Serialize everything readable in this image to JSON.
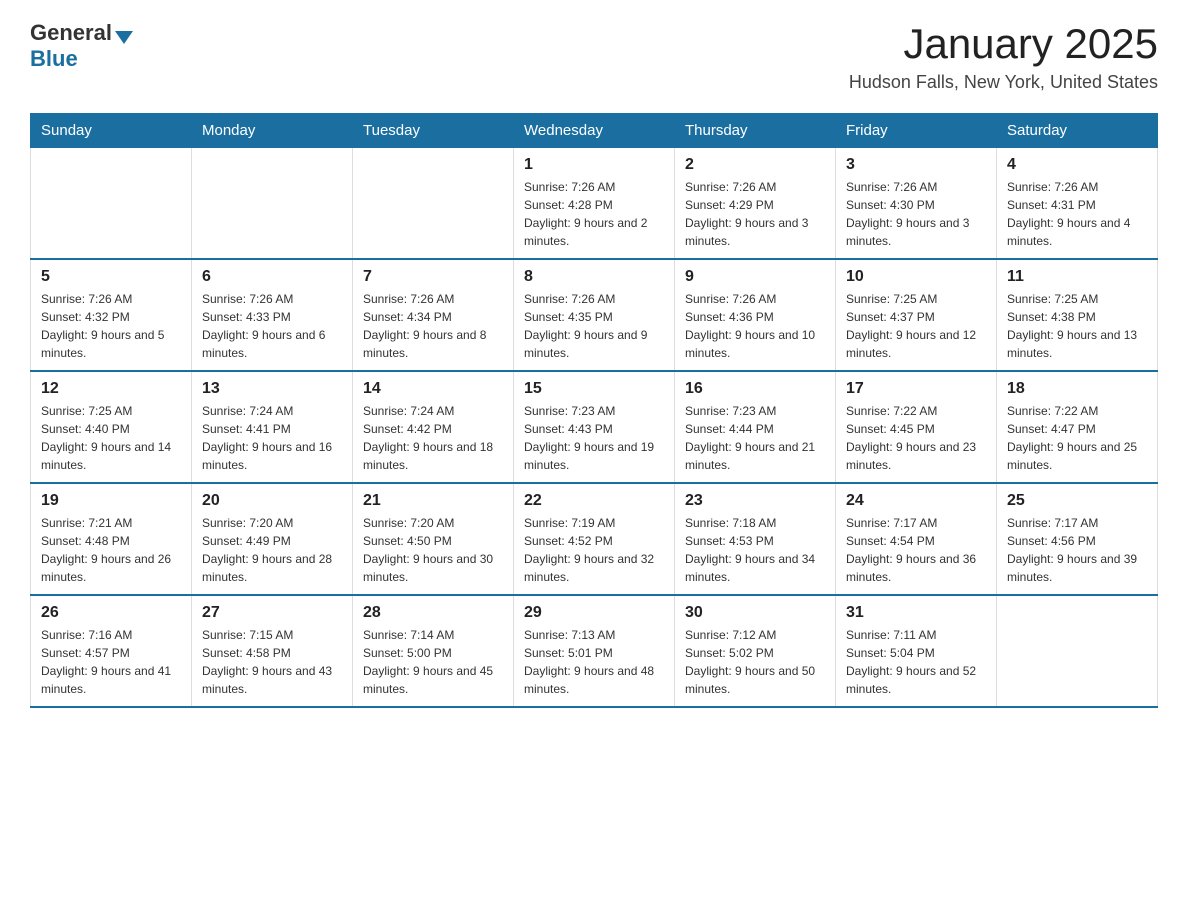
{
  "header": {
    "logo": {
      "general_text": "General",
      "blue_text": "Blue"
    },
    "title": "January 2025",
    "subtitle": "Hudson Falls, New York, United States"
  },
  "days_of_week": [
    "Sunday",
    "Monday",
    "Tuesday",
    "Wednesday",
    "Thursday",
    "Friday",
    "Saturday"
  ],
  "weeks": [
    {
      "days": [
        {
          "number": "",
          "info": ""
        },
        {
          "number": "",
          "info": ""
        },
        {
          "number": "",
          "info": ""
        },
        {
          "number": "1",
          "info": "Sunrise: 7:26 AM\nSunset: 4:28 PM\nDaylight: 9 hours and 2 minutes."
        },
        {
          "number": "2",
          "info": "Sunrise: 7:26 AM\nSunset: 4:29 PM\nDaylight: 9 hours and 3 minutes."
        },
        {
          "number": "3",
          "info": "Sunrise: 7:26 AM\nSunset: 4:30 PM\nDaylight: 9 hours and 3 minutes."
        },
        {
          "number": "4",
          "info": "Sunrise: 7:26 AM\nSunset: 4:31 PM\nDaylight: 9 hours and 4 minutes."
        }
      ]
    },
    {
      "days": [
        {
          "number": "5",
          "info": "Sunrise: 7:26 AM\nSunset: 4:32 PM\nDaylight: 9 hours and 5 minutes."
        },
        {
          "number": "6",
          "info": "Sunrise: 7:26 AM\nSunset: 4:33 PM\nDaylight: 9 hours and 6 minutes."
        },
        {
          "number": "7",
          "info": "Sunrise: 7:26 AM\nSunset: 4:34 PM\nDaylight: 9 hours and 8 minutes."
        },
        {
          "number": "8",
          "info": "Sunrise: 7:26 AM\nSunset: 4:35 PM\nDaylight: 9 hours and 9 minutes."
        },
        {
          "number": "9",
          "info": "Sunrise: 7:26 AM\nSunset: 4:36 PM\nDaylight: 9 hours and 10 minutes."
        },
        {
          "number": "10",
          "info": "Sunrise: 7:25 AM\nSunset: 4:37 PM\nDaylight: 9 hours and 12 minutes."
        },
        {
          "number": "11",
          "info": "Sunrise: 7:25 AM\nSunset: 4:38 PM\nDaylight: 9 hours and 13 minutes."
        }
      ]
    },
    {
      "days": [
        {
          "number": "12",
          "info": "Sunrise: 7:25 AM\nSunset: 4:40 PM\nDaylight: 9 hours and 14 minutes."
        },
        {
          "number": "13",
          "info": "Sunrise: 7:24 AM\nSunset: 4:41 PM\nDaylight: 9 hours and 16 minutes."
        },
        {
          "number": "14",
          "info": "Sunrise: 7:24 AM\nSunset: 4:42 PM\nDaylight: 9 hours and 18 minutes."
        },
        {
          "number": "15",
          "info": "Sunrise: 7:23 AM\nSunset: 4:43 PM\nDaylight: 9 hours and 19 minutes."
        },
        {
          "number": "16",
          "info": "Sunrise: 7:23 AM\nSunset: 4:44 PM\nDaylight: 9 hours and 21 minutes."
        },
        {
          "number": "17",
          "info": "Sunrise: 7:22 AM\nSunset: 4:45 PM\nDaylight: 9 hours and 23 minutes."
        },
        {
          "number": "18",
          "info": "Sunrise: 7:22 AM\nSunset: 4:47 PM\nDaylight: 9 hours and 25 minutes."
        }
      ]
    },
    {
      "days": [
        {
          "number": "19",
          "info": "Sunrise: 7:21 AM\nSunset: 4:48 PM\nDaylight: 9 hours and 26 minutes."
        },
        {
          "number": "20",
          "info": "Sunrise: 7:20 AM\nSunset: 4:49 PM\nDaylight: 9 hours and 28 minutes."
        },
        {
          "number": "21",
          "info": "Sunrise: 7:20 AM\nSunset: 4:50 PM\nDaylight: 9 hours and 30 minutes."
        },
        {
          "number": "22",
          "info": "Sunrise: 7:19 AM\nSunset: 4:52 PM\nDaylight: 9 hours and 32 minutes."
        },
        {
          "number": "23",
          "info": "Sunrise: 7:18 AM\nSunset: 4:53 PM\nDaylight: 9 hours and 34 minutes."
        },
        {
          "number": "24",
          "info": "Sunrise: 7:17 AM\nSunset: 4:54 PM\nDaylight: 9 hours and 36 minutes."
        },
        {
          "number": "25",
          "info": "Sunrise: 7:17 AM\nSunset: 4:56 PM\nDaylight: 9 hours and 39 minutes."
        }
      ]
    },
    {
      "days": [
        {
          "number": "26",
          "info": "Sunrise: 7:16 AM\nSunset: 4:57 PM\nDaylight: 9 hours and 41 minutes."
        },
        {
          "number": "27",
          "info": "Sunrise: 7:15 AM\nSunset: 4:58 PM\nDaylight: 9 hours and 43 minutes."
        },
        {
          "number": "28",
          "info": "Sunrise: 7:14 AM\nSunset: 5:00 PM\nDaylight: 9 hours and 45 minutes."
        },
        {
          "number": "29",
          "info": "Sunrise: 7:13 AM\nSunset: 5:01 PM\nDaylight: 9 hours and 48 minutes."
        },
        {
          "number": "30",
          "info": "Sunrise: 7:12 AM\nSunset: 5:02 PM\nDaylight: 9 hours and 50 minutes."
        },
        {
          "number": "31",
          "info": "Sunrise: 7:11 AM\nSunset: 5:04 PM\nDaylight: 9 hours and 52 minutes."
        },
        {
          "number": "",
          "info": ""
        }
      ]
    }
  ]
}
